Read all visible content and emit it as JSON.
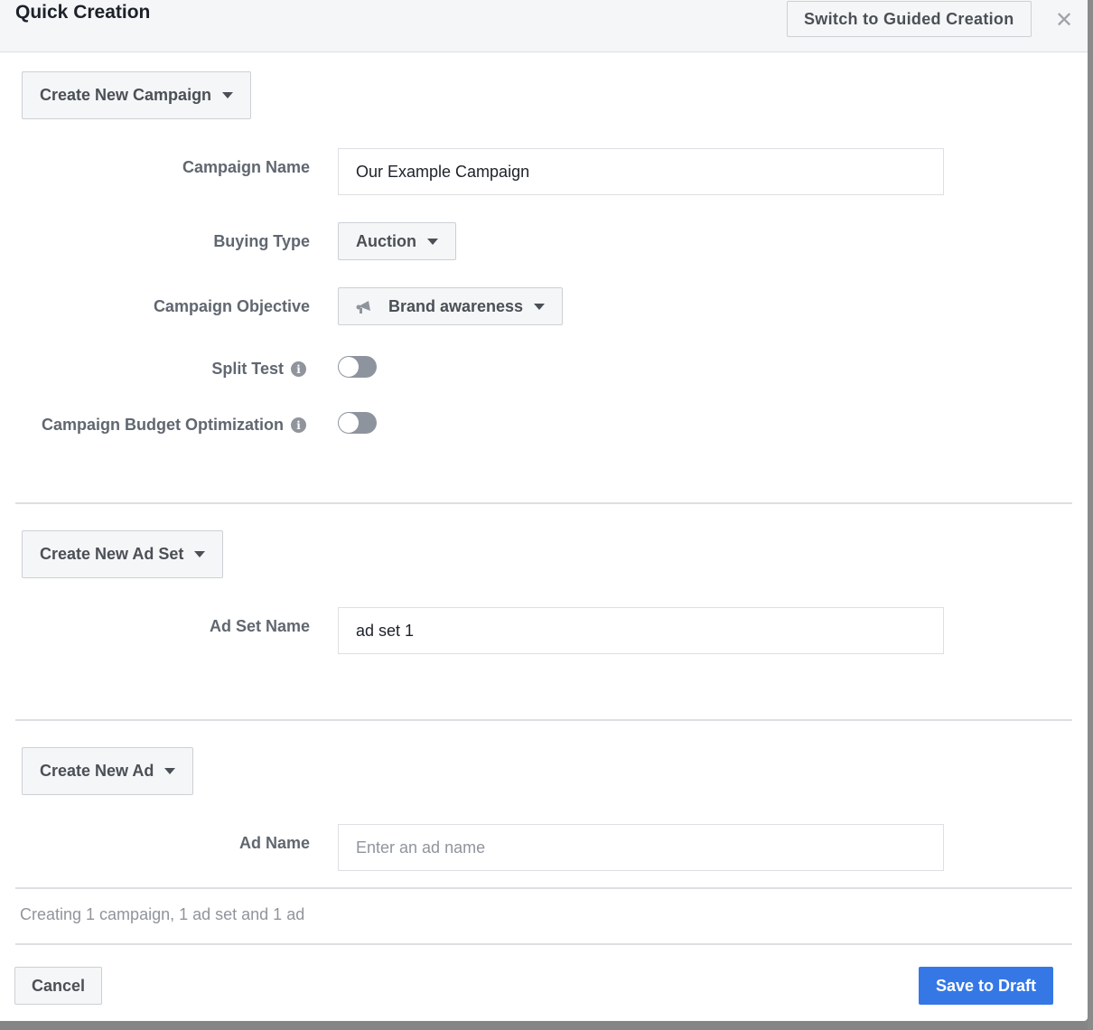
{
  "header": {
    "title": "Quick Creation",
    "switch_button": "Switch to Guided Creation",
    "close_icon": "close-icon"
  },
  "campaign": {
    "section_button": "Create New Campaign",
    "name_label": "Campaign Name",
    "name_value": "Our Example Campaign",
    "buying_type_label": "Buying Type",
    "buying_type_value": "Auction",
    "objective_label": "Campaign Objective",
    "objective_value": "Brand awareness",
    "objective_icon": "megaphone-icon",
    "split_test_label": "Split Test",
    "split_test_on": false,
    "cbo_label": "Campaign Budget Optimization",
    "cbo_on": false
  },
  "ad_set": {
    "section_button": "Create New Ad Set",
    "name_label": "Ad Set Name",
    "name_value": "ad set 1"
  },
  "ad": {
    "section_button": "Create New Ad",
    "name_label": "Ad Name",
    "name_placeholder": "Enter an ad name",
    "name_value": ""
  },
  "footer": {
    "summary": "Creating 1 campaign, 1 ad set and 1 ad",
    "cancel_button": "Cancel",
    "save_button": "Save to Draft",
    "save_color": "#3578e5"
  }
}
